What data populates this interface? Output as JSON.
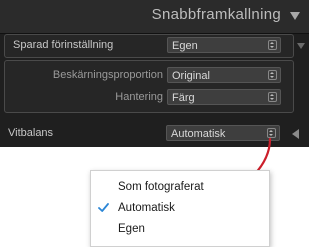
{
  "panel": {
    "title": "Snabbframkallning",
    "preset": {
      "label": "Sparad förinställning",
      "value": "Egen"
    },
    "crop": {
      "label": "Beskärningsproportion",
      "value": "Original"
    },
    "treatment": {
      "label": "Hantering",
      "value": "Färg"
    },
    "white_balance": {
      "label": "Vitbalans",
      "value": "Automatisk"
    }
  },
  "dropdown": {
    "items": [
      {
        "label": "Som fotograferat",
        "checked": false
      },
      {
        "label": "Automatisk",
        "checked": true
      },
      {
        "label": "Egen",
        "checked": false
      }
    ]
  },
  "colors": {
    "panel_bg": "#1f1f1f",
    "check": "#2b86d6",
    "annotation_arrow": "#cc1f2b"
  }
}
